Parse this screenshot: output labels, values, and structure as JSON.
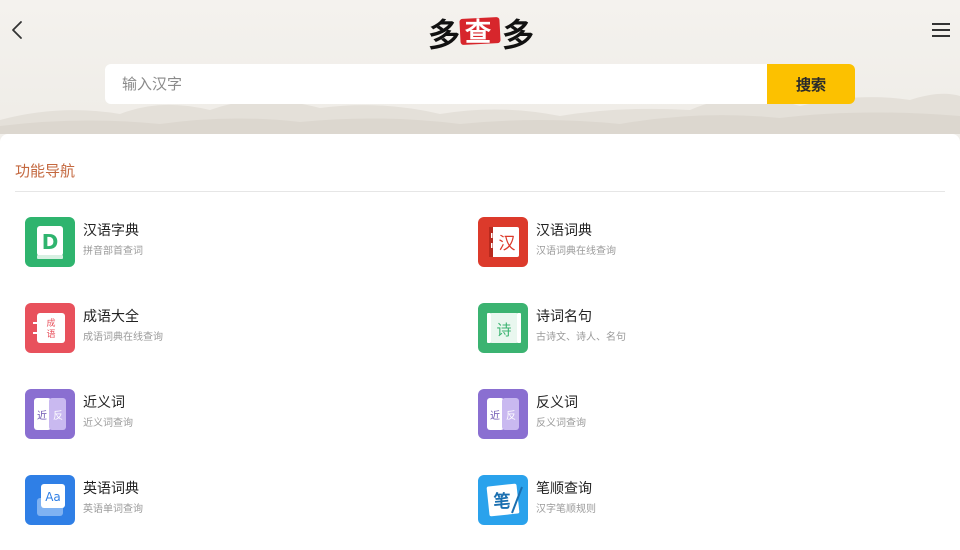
{
  "header": {
    "logo_text": "多查多",
    "search": {
      "placeholder": "输入汉字",
      "value": "",
      "button_label": "搜索"
    }
  },
  "section": {
    "title": "功能导航"
  },
  "features": [
    {
      "name": "汉语字典",
      "desc": "拼音部首查词",
      "icon": "dictionary-d-icon",
      "color": "#2fb46e"
    },
    {
      "name": "汉语词典",
      "desc": "汉语词典在线查询",
      "icon": "han-book-icon",
      "color": "#dc3a2b"
    },
    {
      "name": "成语大全",
      "desc": "成语词典在线查询",
      "icon": "idiom-book-icon",
      "color": "#e8515c"
    },
    {
      "name": "诗词名句",
      "desc": "古诗文、诗人、名句",
      "icon": "poem-book-icon",
      "color": "#3bb371"
    },
    {
      "name": "近义词",
      "desc": "近义词查询",
      "icon": "synonym-icon",
      "color": "#8a6fd1"
    },
    {
      "name": "反义词",
      "desc": "反义词查询",
      "icon": "antonym-icon",
      "color": "#8a6fd1"
    },
    {
      "name": "英语词典",
      "desc": "英语单词查询",
      "icon": "english-dict-icon",
      "color": "#2f7fe6"
    },
    {
      "name": "笔顺查询",
      "desc": "汉字笔顺规则",
      "icon": "stroke-order-icon",
      "color": "#2aa2ec"
    }
  ]
}
